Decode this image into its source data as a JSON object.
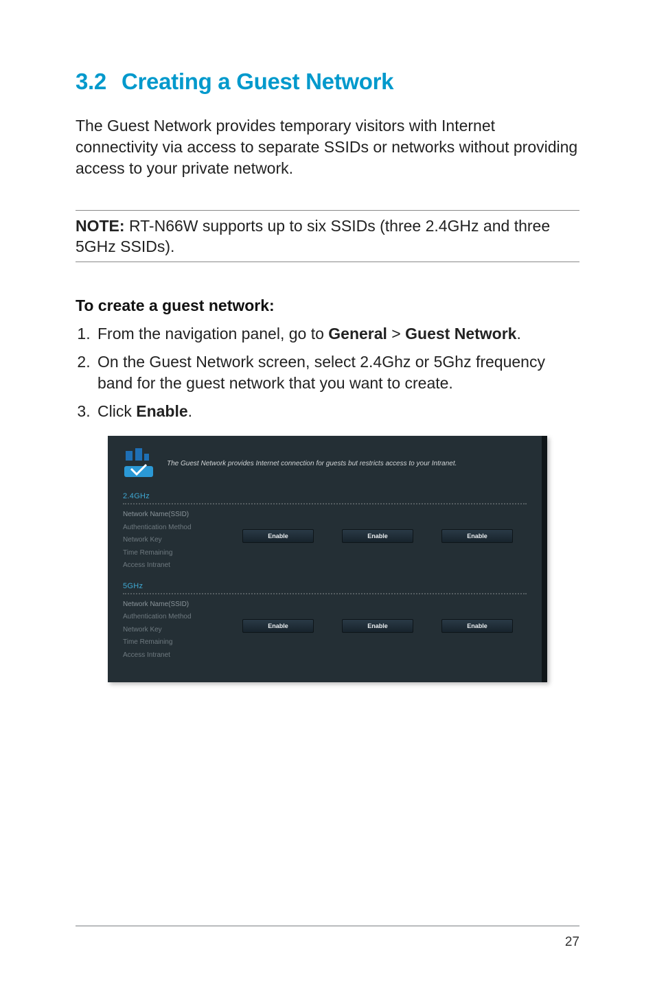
{
  "heading": {
    "number": "3.2",
    "title": "Creating a Guest Network"
  },
  "intro": "The Guest Network provides temporary visitors with Internet connectivity via access to separate SSIDs or networks without providing access to your private network.",
  "note": {
    "label": "NOTE:",
    "text": " RT-N66W supports up to six SSIDs (three 2.4GHz and three 5GHz SSIDs)."
  },
  "procedure": {
    "heading": "To create a guest network:",
    "steps": {
      "s1_pre": "From the navigation panel, go to ",
      "s1_b1": "General",
      "s1_gt": " > ",
      "s1_b2": "Guest Network",
      "s1_post": ".",
      "s2": "On the Guest Network screen, select 2.4Ghz or 5Ghz frequency band for the guest network that you want to create.",
      "s3_pre": "Click ",
      "s3_b1": "Enable",
      "s3_post": "."
    }
  },
  "router": {
    "description": "The Guest Network provides Internet connection for guests but restricts access to your Intranet.",
    "bands": [
      {
        "title": "2.4GHz",
        "fields": [
          "Network Name(SSID)",
          "Authentication Method",
          "Network Key",
          "Time Remaining",
          "Access Intranet"
        ],
        "buttons": [
          "Enable",
          "Enable",
          "Enable"
        ]
      },
      {
        "title": "5GHz",
        "fields": [
          "Network Name(SSID)",
          "Authentication Method",
          "Network Key",
          "Time Remaining",
          "Access Intranet"
        ],
        "buttons": [
          "Enable",
          "Enable",
          "Enable"
        ]
      }
    ]
  },
  "page_number": "27"
}
